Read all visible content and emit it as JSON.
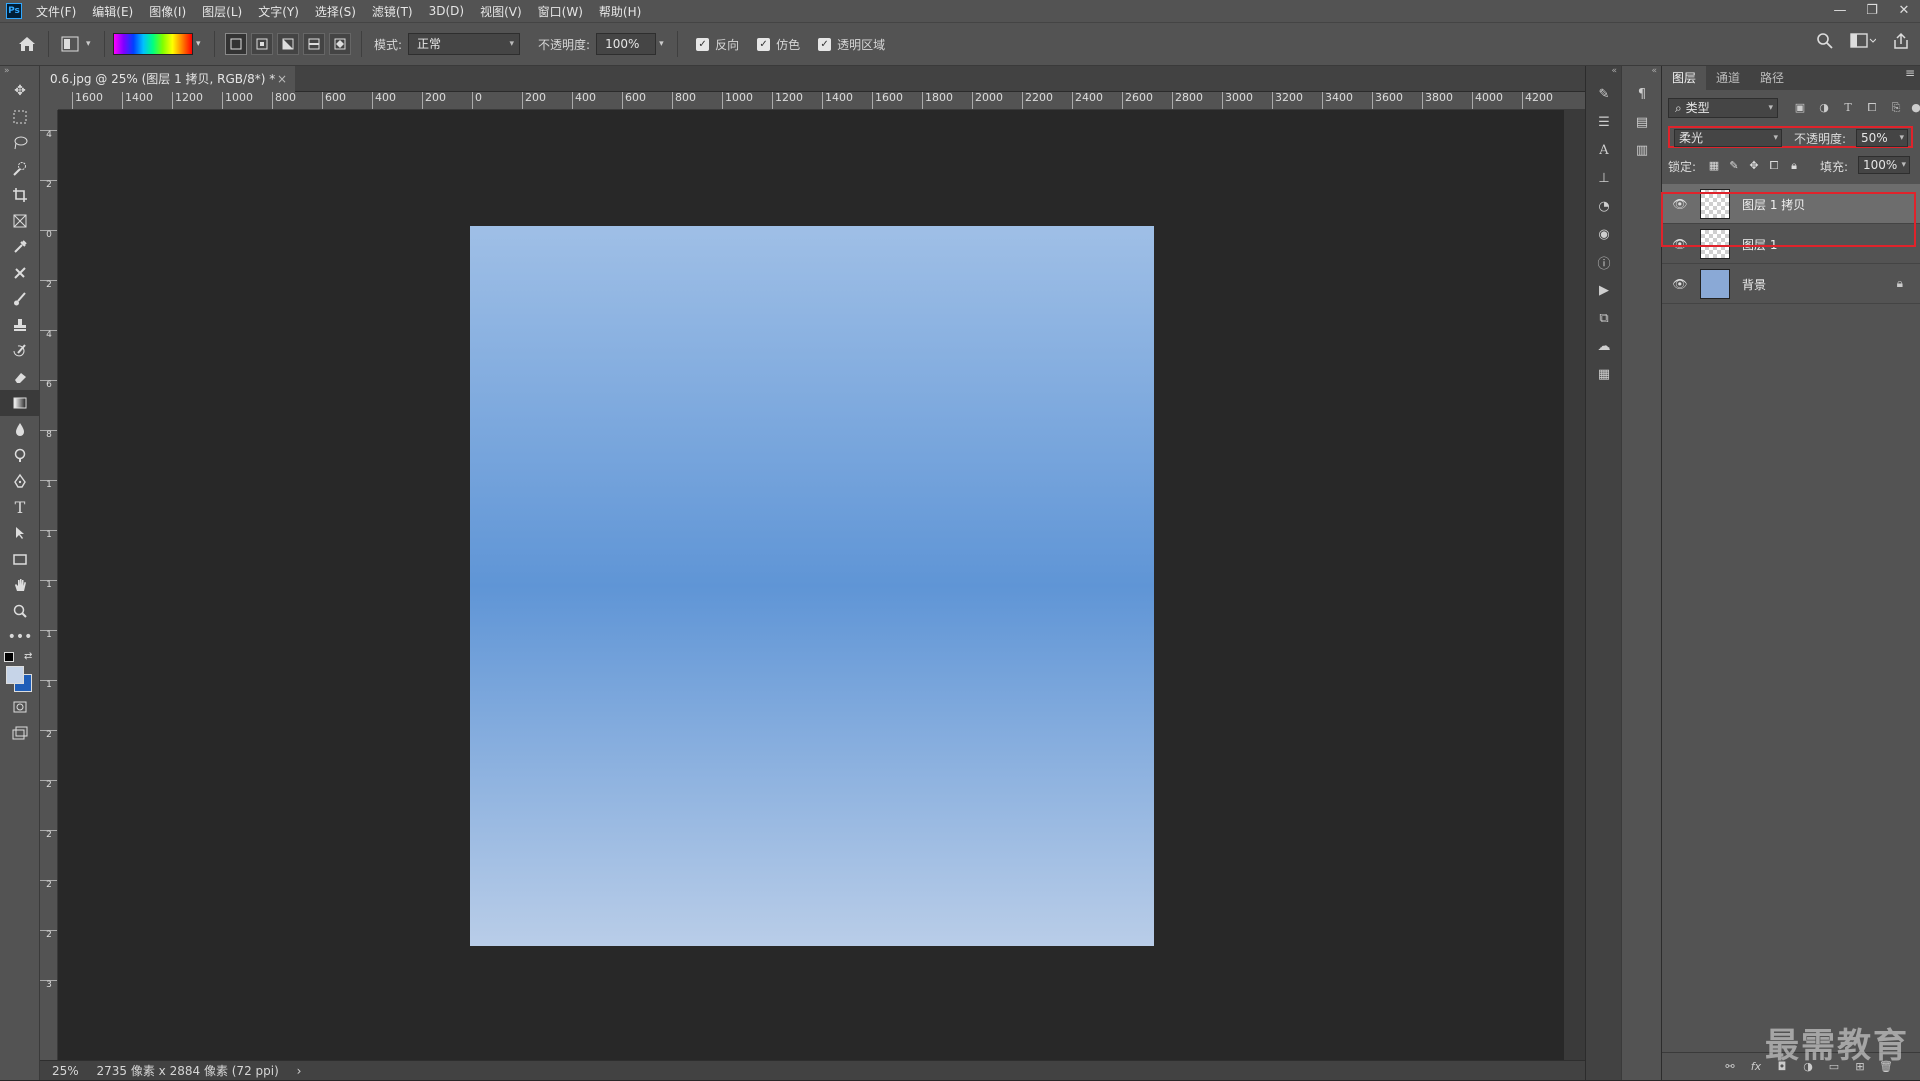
{
  "app": {
    "logo": "Ps"
  },
  "menu": [
    "文件(F)",
    "编辑(E)",
    "图像(I)",
    "图层(L)",
    "文字(Y)",
    "选择(S)",
    "滤镜(T)",
    "3D(D)",
    "视图(V)",
    "窗口(W)",
    "帮助(H)"
  ],
  "window_controls": [
    "—",
    "❐",
    "✕"
  ],
  "options": {
    "mode_label": "模式:",
    "mode_value": "正常",
    "opacity_label": "不透明度:",
    "opacity_value": "100%",
    "checkboxes": [
      "反向",
      "仿色",
      "透明区域"
    ]
  },
  "document": {
    "tab_title": "0.6.jpg @ 25% (图层 1 拷贝, RGB/8*) *",
    "tab_close": "×"
  },
  "ruler": {
    "h_labels": [
      "1600",
      "1400",
      "1200",
      "1000",
      "800",
      "600",
      "400",
      "200",
      "0",
      "200",
      "400",
      "600",
      "800",
      "1000",
      "1200",
      "1400",
      "1600",
      "1800",
      "2000",
      "2200",
      "2400",
      "2600",
      "2800",
      "3000",
      "3200",
      "3400",
      "3600",
      "3800",
      "4000",
      "4200"
    ],
    "v_labels": [
      "4",
      "2",
      "0",
      "2",
      "4",
      "6",
      "8",
      "1",
      "1",
      "1",
      "1",
      "1",
      "2",
      "2",
      "2",
      "2",
      "2",
      "3"
    ]
  },
  "status": {
    "zoom": "25%",
    "dimensions": "2735 像素 x 2884 像素 (72 ppi)",
    "arrow": "›"
  },
  "layers_panel": {
    "tabs": [
      "图层",
      "通道",
      "路径"
    ],
    "filter_label": "类型",
    "blend_mode": "柔光",
    "opacity_label": "不透明度:",
    "opacity_value": "50%",
    "lock_label": "锁定:",
    "fill_label": "填充:",
    "fill_value": "100%",
    "layers": [
      {
        "name": "图层 1 拷贝",
        "selected": true
      },
      {
        "name": "图层 1",
        "selected": false
      },
      {
        "name": "背景",
        "selected": false,
        "locked": true
      }
    ]
  },
  "watermark": "最需教育",
  "colors": {
    "highlight_red": "#e0232b",
    "panel": "#535353",
    "canvas_bg": "#282828",
    "foreground": "#c6d4e8",
    "background": "#1f5eb8"
  }
}
